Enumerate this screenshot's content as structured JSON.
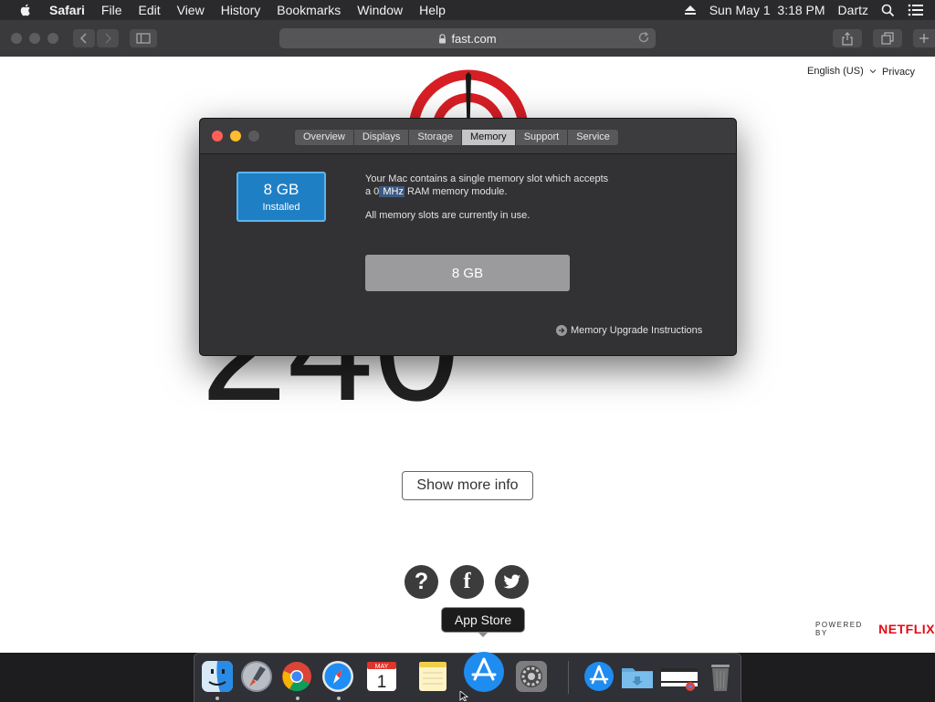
{
  "menubar": {
    "app_name": "Safari",
    "menus": [
      "File",
      "Edit",
      "View",
      "History",
      "Bookmarks",
      "Window",
      "Help"
    ],
    "datetime": "Sun May 1  3:18 PM",
    "user": "Dartz",
    "icons": [
      "apple-icon",
      "eject-icon",
      "search-icon",
      "list-icon"
    ]
  },
  "toolbar": {
    "url": "fast.com"
  },
  "webpage": {
    "language": "English (US)",
    "privacy": "Privacy",
    "speed_value": "240",
    "show_more_label": "Show more info",
    "social": [
      "help-icon",
      "facebook-icon",
      "twitter-icon"
    ],
    "powered_by": "POWERED BY",
    "brand": "NETFLIX",
    "brand_color": "#e50914"
  },
  "dialog": {
    "tabs": [
      "Overview",
      "Displays",
      "Storage",
      "Memory",
      "Support",
      "Service"
    ],
    "active_tab": "Memory",
    "memory_size": "8 GB",
    "memory_status": "Installed",
    "desc_line1": "Your Mac contains a single memory slot which accepts",
    "desc_line2_prefix": "a 0",
    "desc_line2_highlight": " MHz",
    "desc_line2_suffix": " RAM memory module.",
    "slots_status": "All memory slots are currently in use.",
    "slot_label": "8 GB",
    "upgrade_link": "Memory Upgrade Instructions"
  },
  "tooltip": "App Store",
  "dock": {
    "items": [
      "finder-icon",
      "launchpad-icon",
      "chrome-icon",
      "safari-icon",
      "calendar-icon",
      "notes-icon",
      "app-store-icon",
      "system-preferences-icon",
      "app-store-downloads-icon",
      "folder-icon",
      "chrome-window-icon",
      "trash-icon"
    ],
    "calendar_month": "MAY",
    "calendar_day": "1"
  }
}
